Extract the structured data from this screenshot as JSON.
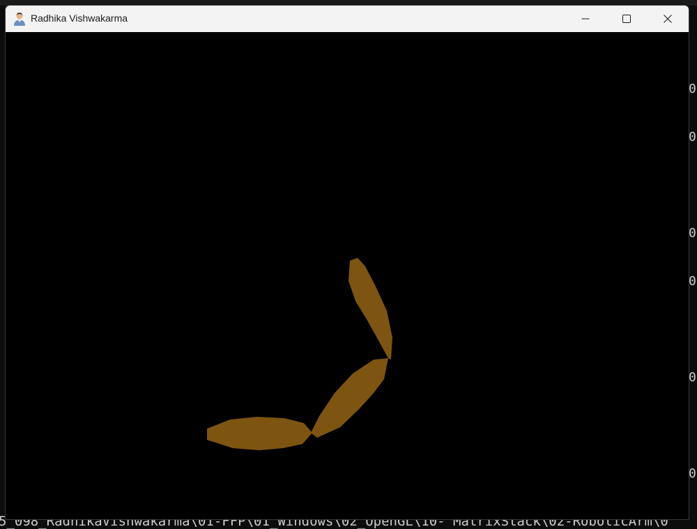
{
  "window": {
    "title": "Radhika Vishwakarma",
    "icon": "user-avatar-icon",
    "controls": {
      "minimize": "minimize-icon",
      "maximize": "maximize-icon",
      "close": "close-icon"
    }
  },
  "scene": {
    "background_color": "#000000",
    "arm_color": "#7d5510",
    "segments": [
      "shoulder-segment",
      "elbow-segment",
      "wrist-segment"
    ]
  },
  "background_terminal": {
    "right_glyphs": [
      "0",
      "0",
      "0",
      "0",
      "0",
      "0"
    ],
    "bottom_line": "5_098_RadhikaVishwakarma\\01-FFP\\01_Windows\\02_OpenGL\\10- MatrixStack\\02-RoboticArm\\0"
  }
}
